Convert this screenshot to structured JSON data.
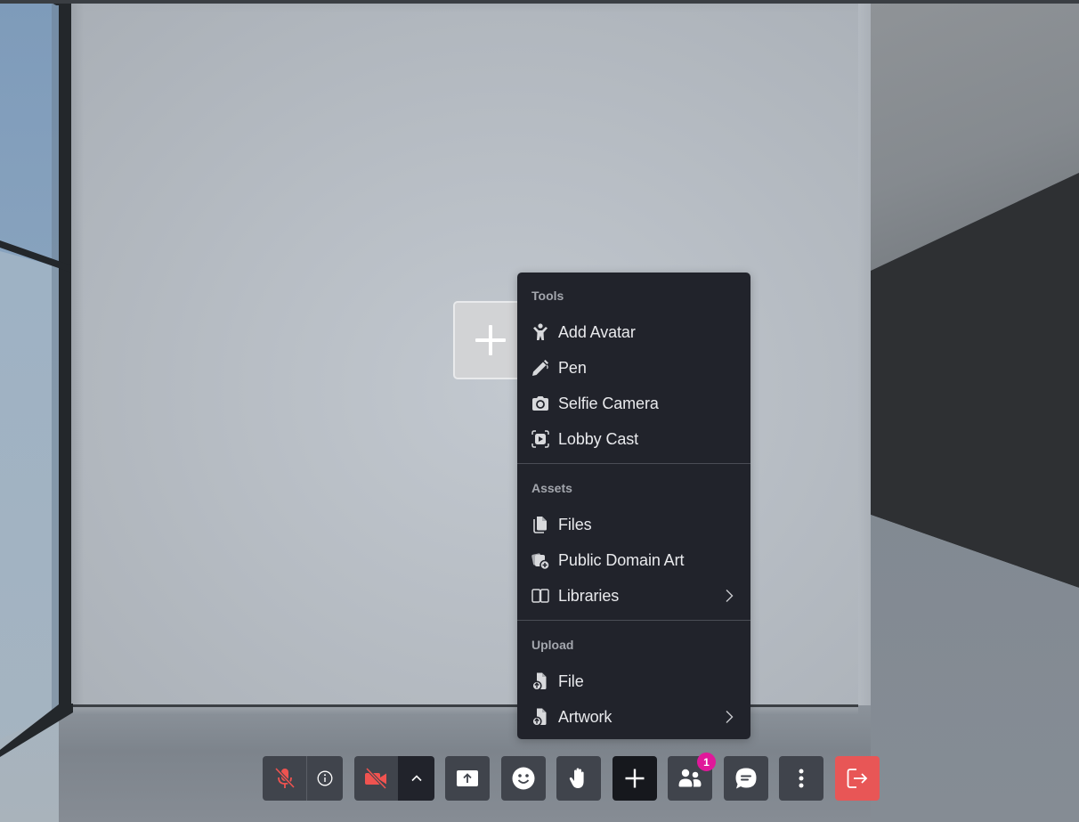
{
  "scene": {
    "wall_add_label": "Add content to wall"
  },
  "menu": {
    "sections": [
      {
        "title": "Tools",
        "items": [
          {
            "label": "Add Avatar",
            "icon": "person-arms-up-icon"
          },
          {
            "label": "Pen",
            "icon": "pen-icon"
          },
          {
            "label": "Selfie Camera",
            "icon": "camera-icon"
          },
          {
            "label": "Lobby Cast",
            "icon": "cast-play-icon"
          }
        ]
      },
      {
        "title": "Assets",
        "items": [
          {
            "label": "Files",
            "icon": "files-icon"
          },
          {
            "label": "Public Domain Art",
            "icon": "art-collection-add-icon"
          },
          {
            "label": "Libraries",
            "icon": "book-open-icon",
            "submenu": true
          }
        ]
      },
      {
        "title": "Upload",
        "items": [
          {
            "label": "File",
            "icon": "file-upload-icon"
          },
          {
            "label": "Artwork",
            "icon": "artwork-upload-icon",
            "submenu": true
          }
        ]
      }
    ]
  },
  "toolbar": {
    "mic": {
      "state": "muted",
      "icon": "mic-off-icon"
    },
    "audio_info": {
      "icon": "info-icon"
    },
    "camera": {
      "state": "off",
      "icon": "video-off-icon"
    },
    "camera_options": {
      "icon": "chevron-up-icon"
    },
    "share_screen": {
      "icon": "screen-share-icon"
    },
    "reactions": {
      "icon": "smiley-icon"
    },
    "raise_hand": {
      "icon": "hand-icon"
    },
    "add": {
      "icon": "plus-icon",
      "active": true
    },
    "participants": {
      "icon": "people-icon",
      "badge": "1"
    },
    "chat": {
      "icon": "chat-bubble-icon"
    },
    "more": {
      "icon": "more-vertical-icon"
    },
    "leave": {
      "icon": "exit-icon"
    }
  },
  "colors": {
    "menu_bg": "#21232b",
    "toolbar_btn": "#40444c",
    "muted_red": "#ef5350",
    "leave_red": "#e85656",
    "badge_pink": "#e0189a"
  }
}
